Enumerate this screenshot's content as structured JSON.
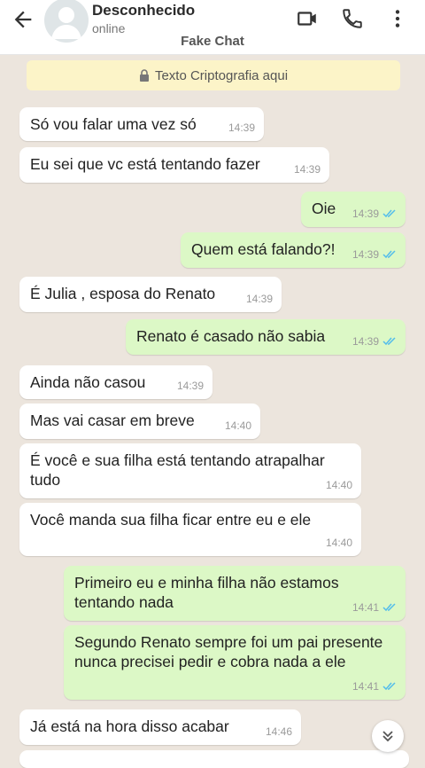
{
  "header": {
    "contact_name": "Desconhecido",
    "contact_status": "online",
    "subtitle": "Fake Chat",
    "icons": [
      "back-arrow-icon",
      "video-call-icon",
      "phone-call-icon",
      "more-options-icon"
    ]
  },
  "encryption_banner": {
    "text": "Texto Criptografia aqui",
    "icon": "lock-icon"
  },
  "messages": [
    {
      "dir": "in",
      "text": "Só vou falar uma vez só",
      "time": "14:39"
    },
    {
      "dir": "in",
      "text": "Eu sei que vc está tentando fazer",
      "time": "14:39"
    },
    {
      "dir": "out",
      "text": "Oie",
      "time": "14:39"
    },
    {
      "dir": "out",
      "text": "Quem está falando?!",
      "time": "14:39"
    },
    {
      "dir": "in",
      "text": "É Julia , esposa do Renato",
      "time": "14:39"
    },
    {
      "dir": "out",
      "text": "Renato é casado não sabia",
      "time": "14:39"
    },
    {
      "dir": "in",
      "text": "Ainda não casou",
      "time": "14:39"
    },
    {
      "dir": "in",
      "text": "Mas vai casar em breve",
      "time": "14:40"
    },
    {
      "dir": "in",
      "text": "É você e sua filha está tentando atrapalhar tudo",
      "time": "14:40"
    },
    {
      "dir": "in",
      "text": "Você manda sua filha ficar entre eu e ele",
      "time": "14:40"
    },
    {
      "dir": "out",
      "text": "Primeiro eu e minha filha não estamos tentando nada",
      "time": "14:41"
    },
    {
      "dir": "out",
      "text": "Segundo Renato sempre foi um pai presente nunca precisei pedir e cobra nada a ele",
      "time": "14:41"
    },
    {
      "dir": "in",
      "text": "Já está na hora disso acabar",
      "time": "14:46"
    }
  ],
  "colors": {
    "incoming": "#ffffff",
    "outgoing": "#dcf8c6",
    "read_ticks": "#53bdeb",
    "background": "#ece5dd"
  }
}
